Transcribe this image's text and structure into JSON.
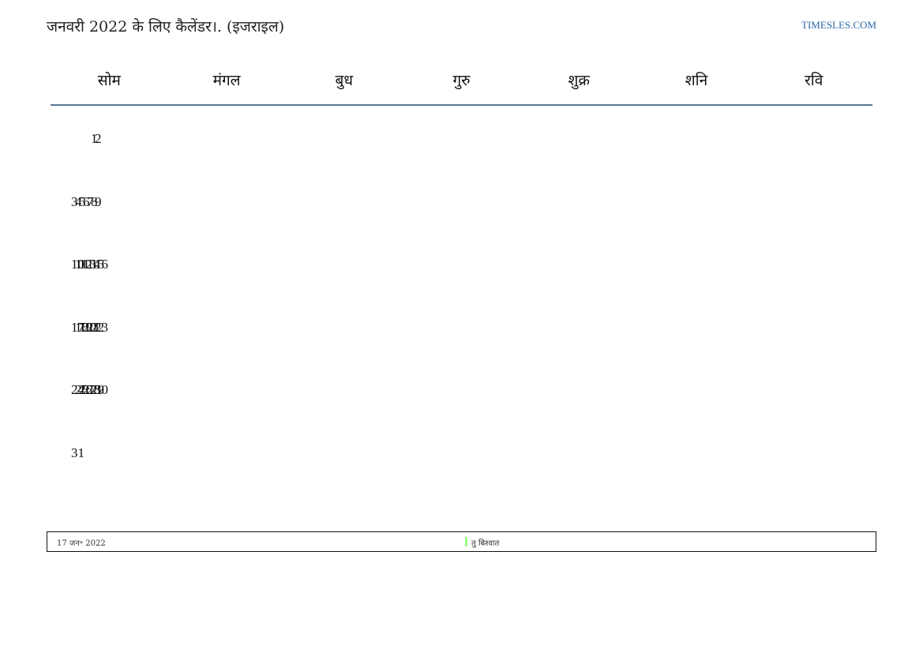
{
  "header": {
    "title": "जनवरी 2022 के लिए कैलेंडर।. (इजराइल)",
    "site": "TIMESLES.COM"
  },
  "weekdays": [
    "सोम",
    "मंगल",
    "बुध",
    "गुरु",
    "शुक्र",
    "शनि",
    "रवि"
  ],
  "weeks": [
    [
      "",
      "",
      "",
      "",
      "",
      "1",
      "2"
    ],
    [
      "3",
      "4",
      "5",
      "6",
      "7",
      "8",
      "9"
    ],
    [
      "10",
      "11",
      "12",
      "13",
      "14",
      "15",
      "16"
    ],
    [
      "17",
      "18",
      "19",
      "20",
      "21",
      "22",
      "23"
    ],
    [
      "24",
      "25",
      "26",
      "27",
      "28",
      "29",
      "30"
    ],
    [
      "31",
      "",
      "",
      "",
      "",
      "",
      ""
    ]
  ],
  "highlighted_date": "17",
  "colors": {
    "holiday": "#9cfb86",
    "weekend": "#f3f3f3",
    "header_rule": "#5a7595",
    "link": "#2a6aa8"
  },
  "legend": {
    "date": "17 जन॰ 2022",
    "holiday_name": "तु बिश्वात"
  }
}
